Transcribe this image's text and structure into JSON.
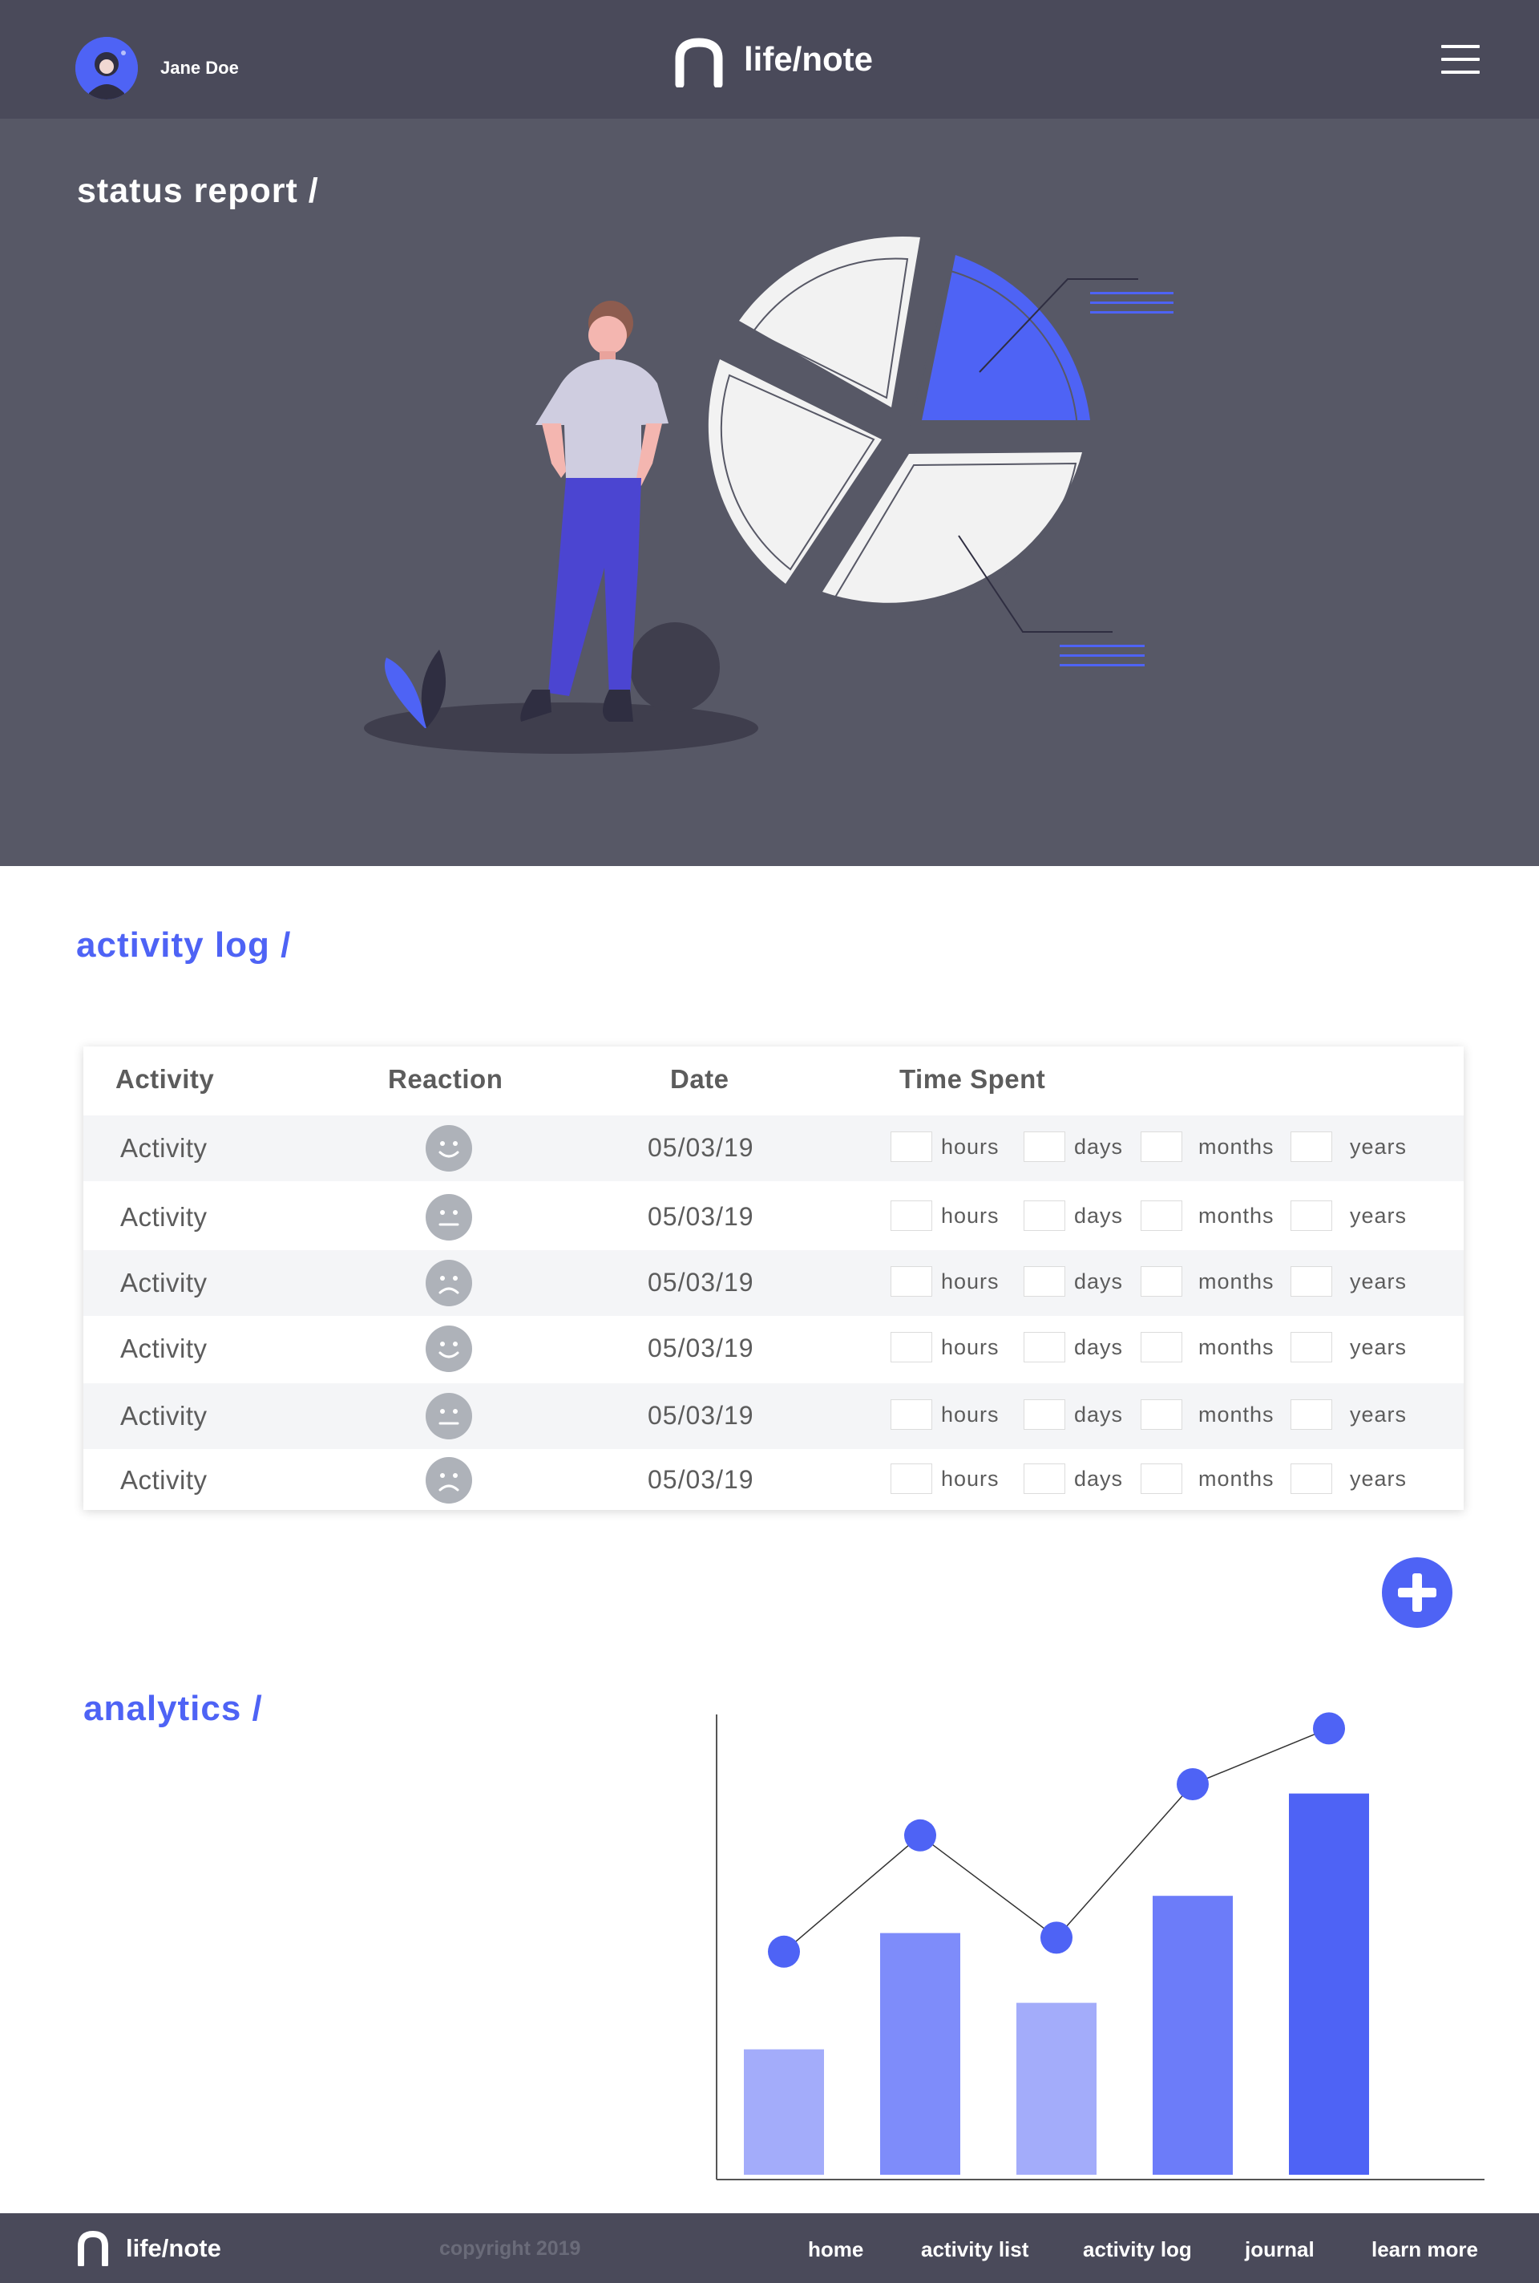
{
  "header": {
    "user_name": "Jane Doe",
    "brand": "life/note"
  },
  "hero": {
    "title": "status report /"
  },
  "activity_log": {
    "title": "activity log /",
    "columns": [
      "Activity",
      "Reaction",
      "Date",
      "Time Spent"
    ],
    "time_units": [
      "hours",
      "days",
      "months",
      "years"
    ],
    "rows": [
      {
        "activity": "Activity",
        "reaction": "happy-face-icon",
        "date": "05/03/19"
      },
      {
        "activity": "Activity",
        "reaction": "neutral-face-icon",
        "date": "05/03/19"
      },
      {
        "activity": "Activity",
        "reaction": "sad-face-icon",
        "date": "05/03/19"
      },
      {
        "activity": "Activity",
        "reaction": "happy-face-icon",
        "date": "05/03/19"
      },
      {
        "activity": "Activity",
        "reaction": "neutral-face-icon",
        "date": "05/03/19"
      },
      {
        "activity": "Activity",
        "reaction": "sad-face-icon",
        "date": "05/03/19"
      }
    ]
  },
  "analytics": {
    "title": "analytics /"
  },
  "chart_data": {
    "type": "bar",
    "categories": [
      "",
      "",
      "",
      "",
      ""
    ],
    "series": [
      {
        "type": "bar",
        "values": [
          28,
          53,
          38,
          61,
          83
        ],
        "colors": [
          "#a3acfa",
          "#7e8cfa",
          "#a3acfa",
          "#6c7cf9",
          "#4e63f5"
        ]
      },
      {
        "type": "line",
        "values": [
          49,
          74,
          52,
          85,
          97
        ],
        "color": "#4e63f5"
      }
    ],
    "ylim": [
      0,
      100
    ],
    "grid": false,
    "legend": "none"
  },
  "footer": {
    "brand": "life/note",
    "copyright": "copyright 2019",
    "links": [
      "home",
      "activity list",
      "activity log",
      "journal",
      "learn more"
    ]
  },
  "colors": {
    "accent": "#4e63f5",
    "header_bg": "#4a4a5a",
    "hero_bg": "#575866"
  }
}
